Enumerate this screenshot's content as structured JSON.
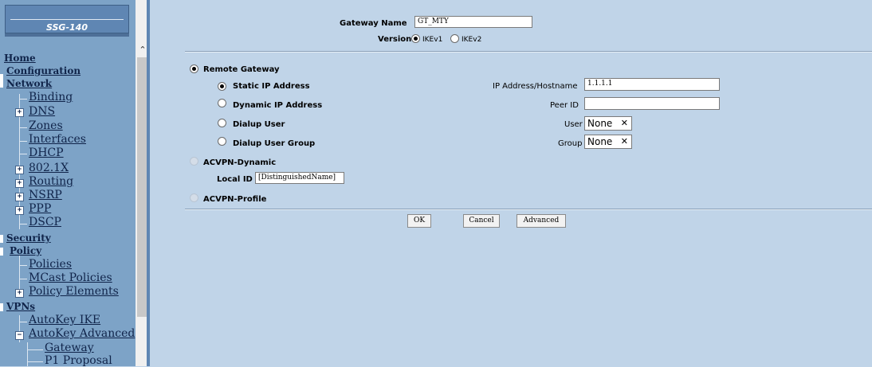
{
  "sidebar": {
    "brand": "SSG-140",
    "items": {
      "home": "Home",
      "configuration": "Configuration",
      "network": "Network",
      "binding": "Binding",
      "dns": "DNS",
      "zones": "Zones",
      "interfaces": "Interfaces",
      "dhcp": "DHCP",
      "dot1x": "802.1X",
      "routing": "Routing",
      "nsrp": "NSRP",
      "ppp": "PPP",
      "dscp": "DSCP",
      "security": "Security",
      "policy": "Policy",
      "policies": "Policies",
      "mcast_policies": "MCast Policies",
      "policy_elements": "Policy Elements",
      "vpns": "VPNs",
      "autokey_ike": "AutoKey IKE",
      "autokey_advanced": "AutoKey Advanced",
      "gateway": "Gateway",
      "p1_proposal": "P1 Proposal"
    }
  },
  "form": {
    "gateway_name_label": "Gateway Name",
    "gateway_name_value": "GT_MTY",
    "version_label": "Version",
    "version_ikev1": "IKEv1",
    "version_ikev2": "IKEv2",
    "remote_gateway": "Remote Gateway",
    "static_ip": "Static IP Address",
    "dynamic_ip": "Dynamic IP Address",
    "dialup_user": "Dialup User",
    "dialup_user_group": "Dialup User Group",
    "ip_host_label": "IP Address/Hostname",
    "ip_host_value": "1.1.1.1",
    "peer_id_label": "Peer ID",
    "peer_id_value": "",
    "user_label": "User",
    "user_value": "None",
    "group_label": "Group",
    "group_value": "None",
    "acvpn_dynamic": "ACVPN-Dynamic",
    "local_id_label": "Local ID",
    "local_id_value": "[DistinguishedName]",
    "acvpn_profile": "ACVPN-Profile"
  },
  "buttons": {
    "ok": "OK",
    "cancel": "Cancel",
    "advanced": "Advanced"
  }
}
